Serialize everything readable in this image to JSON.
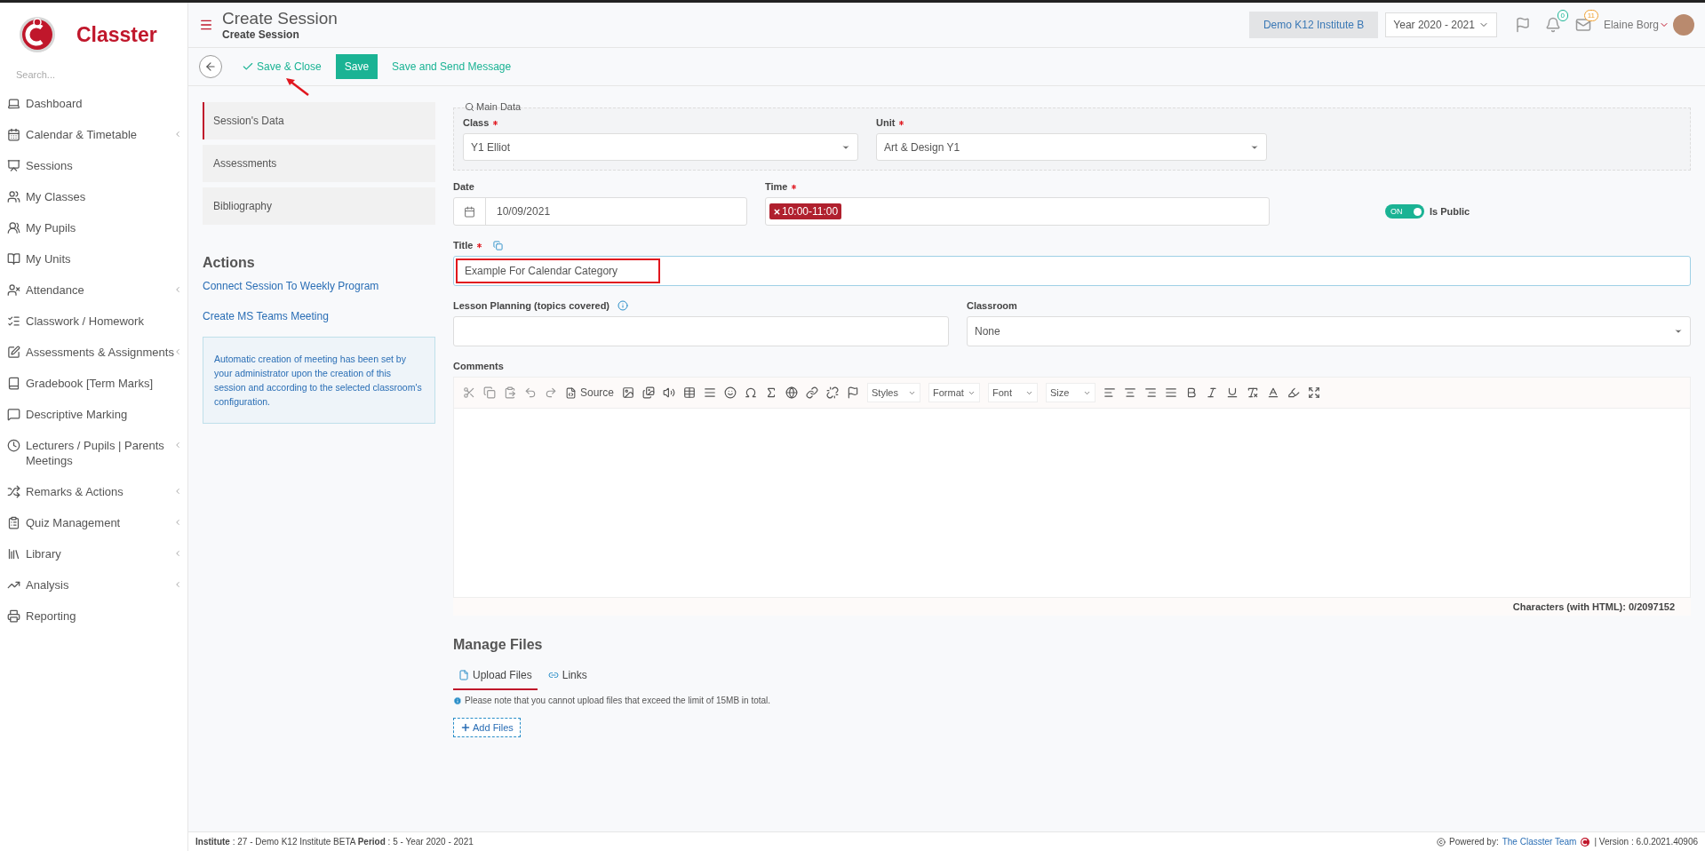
{
  "brand": {
    "name": "Classter"
  },
  "sidebar": {
    "search_placeholder": "Search...",
    "items": [
      {
        "label": "Dashboard",
        "has_submenu": false
      },
      {
        "label": "Calendar & Timetable",
        "has_submenu": true
      },
      {
        "label": "Sessions",
        "has_submenu": false
      },
      {
        "label": "My Classes",
        "has_submenu": false
      },
      {
        "label": "My Pupils",
        "has_submenu": false
      },
      {
        "label": "My Units",
        "has_submenu": false
      },
      {
        "label": "Attendance",
        "has_submenu": true
      },
      {
        "label": "Classwork / Homework",
        "has_submenu": false
      },
      {
        "label": "Assessments & Assignments",
        "has_submenu": true
      },
      {
        "label": "Gradebook [Term Marks]",
        "has_submenu": false
      },
      {
        "label": "Descriptive Marking",
        "has_submenu": false
      },
      {
        "label": "Lecturers / Pupils | Parents Meetings",
        "has_submenu": true
      },
      {
        "label": "Remarks & Actions",
        "has_submenu": true
      },
      {
        "label": "Quiz Management",
        "has_submenu": true
      },
      {
        "label": "Library",
        "has_submenu": true
      },
      {
        "label": "Analysis",
        "has_submenu": true
      },
      {
        "label": "Reporting",
        "has_submenu": false
      }
    ]
  },
  "header": {
    "title": "Create Session",
    "subtitle": "Create Session",
    "institute": "Demo K12 Institute B",
    "year": "Year 2020 - 2021",
    "notifications": "0",
    "messages": "11",
    "user": "Elaine Borg"
  },
  "toolbar": {
    "pointer_arrow": true,
    "buttons": [
      {
        "label": "Save & Close",
        "kind": "check-link"
      },
      {
        "label": "Save",
        "kind": "primary"
      },
      {
        "label": "Save and Send Message",
        "kind": "link"
      }
    ]
  },
  "side_tabs": [
    {
      "label": "Session's Data",
      "selected": true
    },
    {
      "label": "Assessments",
      "selected": false
    },
    {
      "label": "Bibliography",
      "selected": false
    }
  ],
  "actions": {
    "title": "Actions",
    "links": [
      "Connect Session To Weekly Program",
      "Create MS Teams Meeting"
    ],
    "note": "Automatic creation of meeting has been set by your administrator upon the creation of this session and according to the selected classroom's configuration."
  },
  "form": {
    "main_data": {
      "legend": "Main Data",
      "class": {
        "label": "Class",
        "required": true,
        "value": "Y1 Elliot"
      },
      "unit": {
        "label": "Unit",
        "required": true,
        "value": "Art & Design Y1"
      }
    },
    "date": {
      "label": "Date",
      "value": "10/09/2021"
    },
    "time": {
      "label": "Time",
      "required": true,
      "tags": [
        "10:00-11:00"
      ]
    },
    "is_public": {
      "label": "Is Public",
      "on": true,
      "on_text": "ON"
    },
    "title": {
      "label": "Title",
      "required": true,
      "value": "Example For Calendar Category",
      "highlighted": true
    },
    "lesson_planning": {
      "label": "Lesson Planning (topics covered)"
    },
    "classroom": {
      "label": "Classroom",
      "value": "None"
    },
    "comments": {
      "label": "Comments",
      "source_label": "Source",
      "dropdowns": [
        "Styles",
        "Format",
        "Font",
        "Size"
      ],
      "counter": "Characters (with HTML): 0/2097152"
    }
  },
  "files": {
    "title": "Manage Files",
    "tabs": [
      {
        "label": "Upload Files",
        "selected": true
      },
      {
        "label": "Links",
        "selected": false
      }
    ],
    "note": "Please note that you cannot upload files that exceed the limit of 15MB in total.",
    "add_label": "Add Files"
  },
  "footer": {
    "left": "**Institute** : 27 - Demo K12 Institute BETA **Period** : 5 - Year 2020 - 2021",
    "powered": "Powered by:",
    "team": "The Classter Team",
    "version": "| Version : 6.0.2021.40906"
  }
}
